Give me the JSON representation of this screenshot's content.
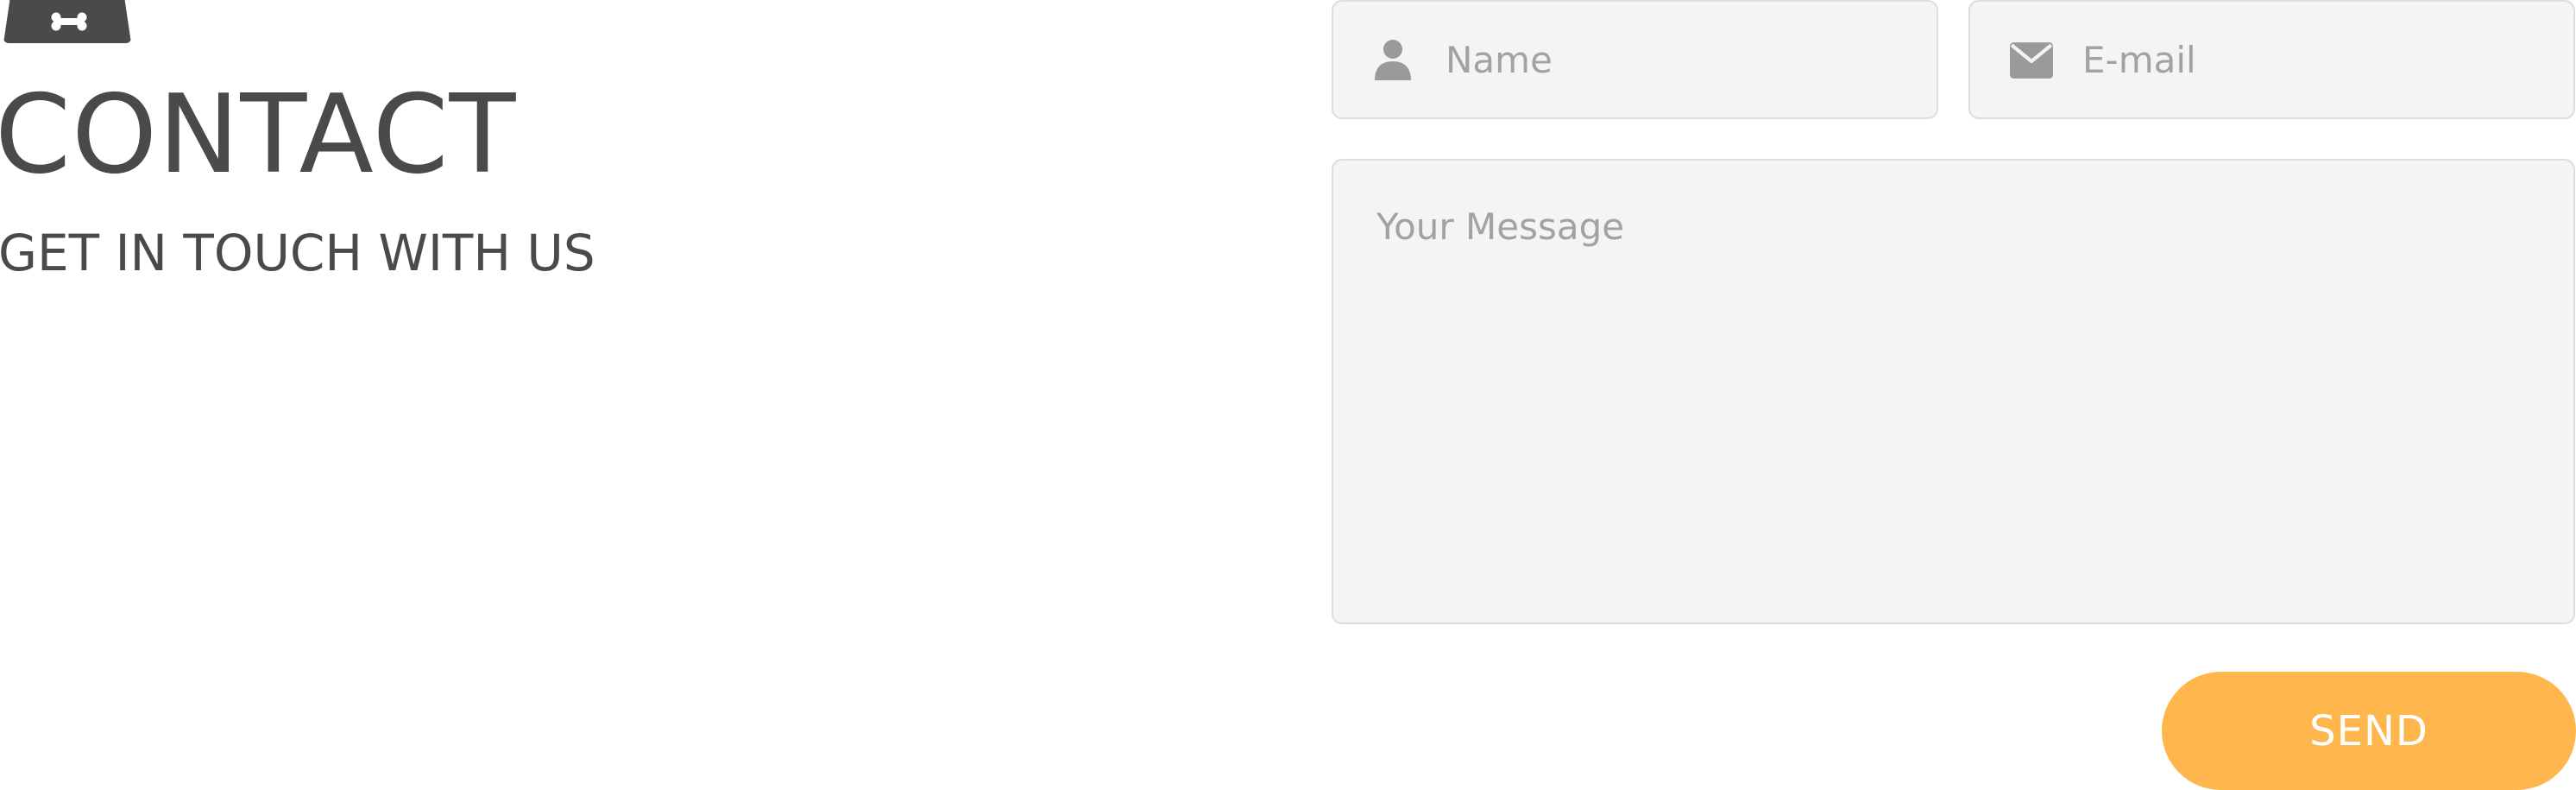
{
  "header": {
    "badge_icon": "bone-icon",
    "title": "CONTACT",
    "subtitle": "GET IN TOUCH WITH US"
  },
  "form": {
    "name": {
      "placeholder": "Name",
      "value": "",
      "icon": "user-icon"
    },
    "email": {
      "placeholder": "E-mail",
      "value": "",
      "icon": "envelope-icon"
    },
    "message": {
      "placeholder": "Your Message",
      "value": ""
    },
    "send_label": "SEND"
  },
  "colors": {
    "text_dark": "#4a4a4a",
    "field_bg": "#f4f4f4",
    "field_border": "#dddddd",
    "placeholder": "#a2a2a2",
    "icon": "#9a9a9a",
    "accent": "#ffb74d"
  }
}
